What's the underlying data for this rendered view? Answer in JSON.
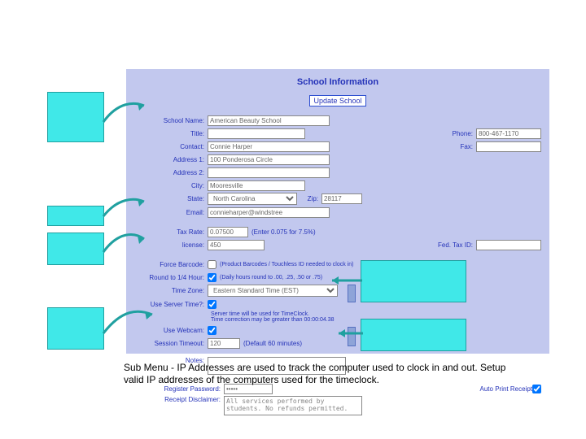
{
  "heading": "School Information",
  "update_button": "Update School",
  "labels": {
    "school_name": "School Name:",
    "title": "Title:",
    "contact": "Contact:",
    "address1": "Address 1:",
    "address2": "Address 2:",
    "city": "City:",
    "state": "State:",
    "zip": "Zip:",
    "email": "Email:",
    "phone": "Phone:",
    "fax": "Fax:",
    "tax_rate": "Tax Rate:",
    "license": "license:",
    "fed_tax_id": "Fed. Tax ID:",
    "force_barcode": "Force Barcode:",
    "round_quarter": "Round to 1/4 Hour:",
    "time_zone": "Time Zone:",
    "use_server_time": "Use Server Time?:",
    "use_webcam": "Use Webcam:",
    "session_timeout": "Session Timeout:",
    "notes": "Notes:",
    "register_password": "Register Password:",
    "receipt_disclaimer": "Receipt Disclaimer:",
    "auto_print": "Auto Print Receipt"
  },
  "values": {
    "school_name": "American Beauty School",
    "title": "",
    "contact": "Connie Harper",
    "address1": "100 Ponderosa Circle",
    "address2": "",
    "city": "Mooresville",
    "state": "North Carolina",
    "zip": "28117",
    "email": "connieharper@windstree",
    "phone": "800-467-1170",
    "fax": "",
    "tax_rate": "0.07500",
    "license": "450",
    "fed_tax_id": "",
    "time_zone": "Eastern Standard Time (EST)",
    "session_timeout": "120",
    "notes": "",
    "register_password": "•••••",
    "receipt_disclaimer": "All services performed by students. No refunds permitted."
  },
  "hints": {
    "tax_rate": "(Enter 0.075 for 7.5%)",
    "force_barcode": "(Product Barcodes / Touchless ID needed to clock in)",
    "round_quarter": "(Daily hours round to .00, .25, .50 or .75)",
    "server_time": "Server time will be used for TimeClock.\nTime correction may be greater than 00:00:04.38",
    "session_timeout": "(Default 60 minutes)"
  },
  "caption": "Sub Menu - IP Addresses are used to track the computer used to clock in and out. Setup valid IP addresses of the computers used for the timeclock."
}
